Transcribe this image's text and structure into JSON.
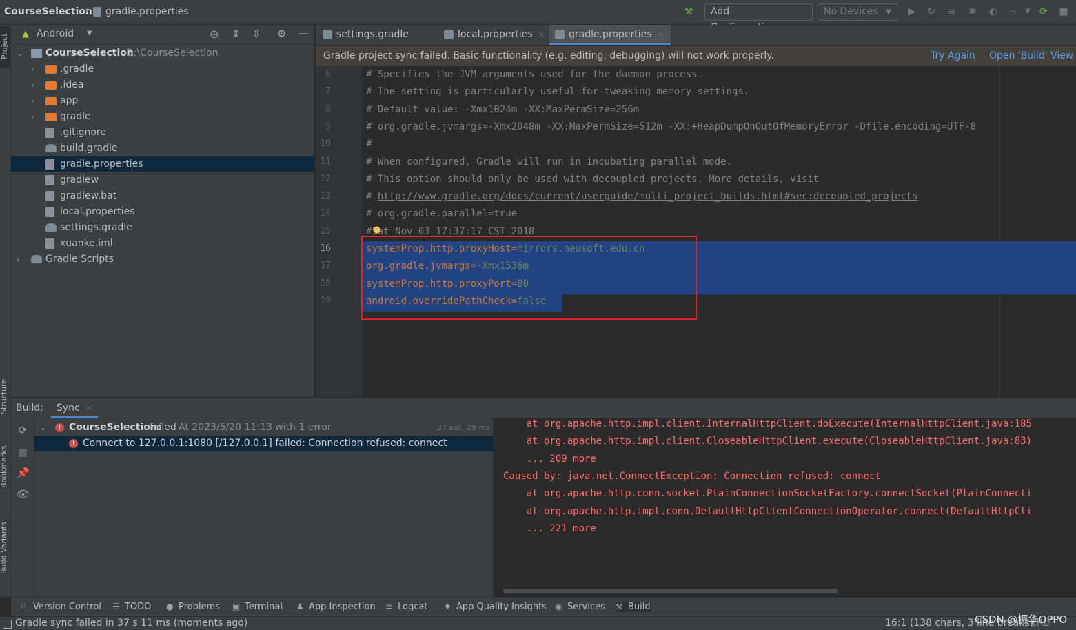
{
  "titlebar": {
    "project": "CourseSelection",
    "file": "gradle.properties",
    "add_config": "Add Configuration...",
    "devices": "No Devices"
  },
  "left_stripe": {
    "project": "Project",
    "structure": "Structure",
    "bookmarks": "Bookmarks",
    "build_variants": "Build Variants"
  },
  "project_panel": {
    "view": "Android",
    "root_name": "CourseSelection",
    "root_path": "D:\\CourseSelection",
    "items": [
      {
        "label": ".gradle",
        "kind": "folder"
      },
      {
        "label": ".idea",
        "kind": "folder"
      },
      {
        "label": "app",
        "kind": "folder"
      },
      {
        "label": "gradle",
        "kind": "folder"
      },
      {
        "label": ".gitignore",
        "kind": "file"
      },
      {
        "label": "build.gradle",
        "kind": "gradle"
      },
      {
        "label": "gradle.properties",
        "kind": "file"
      },
      {
        "label": "gradlew",
        "kind": "file"
      },
      {
        "label": "gradlew.bat",
        "kind": "file"
      },
      {
        "label": "local.properties",
        "kind": "file"
      },
      {
        "label": "settings.gradle",
        "kind": "gradle"
      },
      {
        "label": "xuanke.iml",
        "kind": "file"
      },
      {
        "label": "Gradle Scripts",
        "kind": "gradle"
      }
    ]
  },
  "tabs": [
    {
      "label": "settings.gradle (:)"
    },
    {
      "label": "local.properties"
    },
    {
      "label": "gradle.properties"
    }
  ],
  "banner": {
    "message": "Gradle project sync failed. Basic functionality (e.g. editing, debugging) will not work properly.",
    "try_again": "Try Again",
    "open_build": "Open 'Build' View"
  },
  "editor": {
    "lines": [
      {
        "n": "6",
        "text": "# Specifies the JVM arguments used for the daemon process."
      },
      {
        "n": "7",
        "text": "# The setting is particularly useful for tweaking memory settings."
      },
      {
        "n": "8",
        "text": "# Default value: -Xmx1024m -XX:MaxPermSize=256m"
      },
      {
        "n": "9",
        "text": "# org.gradle.jvmargs=-Xmx2048m -XX:MaxPermSize=512m -XX:+HeapDumpOnOutOfMemoryError -Dfile.encoding=UTF-8"
      },
      {
        "n": "10",
        "text": "#"
      },
      {
        "n": "11",
        "text": "# When configured, Gradle will run in incubating parallel mode."
      },
      {
        "n": "12",
        "text": "# This option should only be used with decoupled projects. More details, visit"
      },
      {
        "n": "13",
        "text": "# ",
        "link": "http://www.gradle.org/docs/current/userguide/multi_project_builds.html#sec:decoupled_projects"
      },
      {
        "n": "14",
        "text": "# org.gradle.parallel=true"
      },
      {
        "n": "15",
        "text": "#Sat Nov 03 17:37:17 CST 2018"
      }
    ],
    "selected_lines": [
      {
        "n": "16",
        "key": "systemProp.http.proxyHost",
        "val": "mirrors.neusoft.edu.cn"
      },
      {
        "n": "17",
        "key": "org.gradle.jvmargs",
        "val": "-Xmx1536m"
      },
      {
        "n": "18",
        "key": "systemProp.http.proxyPort",
        "val": "80"
      },
      {
        "n": "19",
        "key": "android.overridePathCheck",
        "val": "false"
      }
    ]
  },
  "build": {
    "label": "Build:",
    "tab": "Sync",
    "root": "CourseSelection:",
    "root_status": "failed",
    "root_detail": "At 2023/5/20 11:13 with 1 error",
    "root_time": "37 sec, 29 ms",
    "error": "Connect to 127.0.0.1:1080 [/127.0.0.1] failed: Connection refused: connect",
    "console": [
      "    at org.apache.http.impl.client.InternalHttpClient.doExecute(InternalHttpClient.java:185",
      "    at org.apache.http.impl.client.CloseableHttpClient.execute(CloseableHttpClient.java:83)",
      "    ... 209 more",
      "Caused by: java.net.ConnectException: Connection refused: connect",
      "    at org.apache.http.conn.socket.PlainConnectionSocketFactory.connectSocket(PlainConnecti",
      "    at org.apache.http.impl.conn.DefaultHttpClientConnectionOperator.connect(DefaultHttpCli",
      "    ... 221 more"
    ]
  },
  "toolwindows": [
    {
      "label": "Version Control",
      "icon": "branch-icon"
    },
    {
      "label": "TODO",
      "icon": "list-icon"
    },
    {
      "label": "Problems",
      "icon": "info-icon"
    },
    {
      "label": "Terminal",
      "icon": "terminal-icon"
    },
    {
      "label": "App Inspection",
      "icon": "inspect-icon"
    },
    {
      "label": "Logcat",
      "icon": "logcat-icon"
    },
    {
      "label": "App Quality Insights",
      "icon": "shield-icon"
    },
    {
      "label": "Services",
      "icon": "services-icon"
    },
    {
      "label": "Build",
      "icon": "hammer-icon"
    }
  ],
  "status": {
    "message": "Gradle sync failed in 37 s 11 ms (moments ago)",
    "position": "16:1 (138 chars, 3 line breaks)",
    "line_sep": "CRLF",
    "watermark": "CSDN @振华OPPO"
  },
  "colors": {
    "selection": "#214283",
    "highlight_box": "#e0242b",
    "error": "#ff6b68",
    "link": "#589df6"
  }
}
